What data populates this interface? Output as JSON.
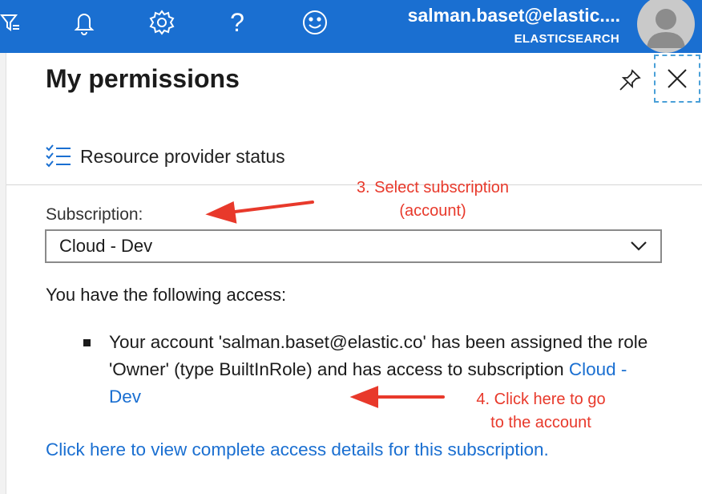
{
  "topbar": {
    "icons": [
      "filter-icon",
      "bell-icon",
      "gear-icon",
      "help-icon",
      "smiley-icon"
    ],
    "help_glyph": "?",
    "user_email": "salman.baset@elastic....",
    "user_tenant": "ELASTICSEARCH",
    "accent_color": "#1a6fd1"
  },
  "panel": {
    "title": "My permissions",
    "pin_icon": "pin-icon",
    "close_icon": "close-icon",
    "resource_provider_status": "Resource provider status",
    "subscription_label": "Subscription:",
    "subscription_selected": "Cloud - Dev",
    "access_heading": "You have the following access:",
    "access_item": {
      "text_before_link": "Your account 'salman.baset@elastic.co' has been assigned the role 'Owner' (type BuiltInRole) and has access to subscription ",
      "link_text": "Cloud - Dev"
    },
    "details_link": "Click here to view complete access details for this subscription."
  },
  "annotations": {
    "color": "#e8392b",
    "select_subscription_line1": "3. Select subscription",
    "select_subscription_line2": "(account)",
    "click_here_line1": "4. Click here to go",
    "click_here_line2": "to the account"
  }
}
